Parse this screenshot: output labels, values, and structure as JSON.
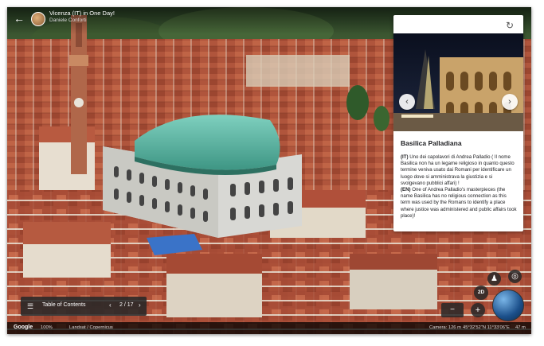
{
  "header": {
    "title": "Vicenza (IT) in One Day!",
    "subtitle": "Daniele Conforti"
  },
  "panel": {
    "place_title": "Basilica Palladiana",
    "desc_it_label": "(IT)",
    "desc_it": "Uno dei capolavori di Andrea Palladio ( Il nome Basilica non ha un legame religioso in quanto questo termine veniva usato dai Romani per identificare un luogo dove si amministrava la giustizia e si svolgevano pubblici affari) !",
    "desc_en_label": "(EN)",
    "desc_en": "One of Andrea Palladio's masterpieces (the name Basilica has no religious connection as this term was used by the Romans to identify a place where justice was administered and public affairs took place)!"
  },
  "toc": {
    "label": "Table of Contents",
    "page": "2 / 17"
  },
  "bottom_bar": {
    "google": "Google",
    "zoom": "100%",
    "attribution": "Landsat / Copernicus",
    "camera": "Camera: 126 m",
    "coords": "45°32'52\"N 11°33'06\"E",
    "alt": "47 m"
  },
  "controls": {
    "view_2d": "2D"
  },
  "colors": {
    "roof": "#b4543c",
    "dome": "#5fb8a8",
    "panel_bg": "#ffffff"
  }
}
